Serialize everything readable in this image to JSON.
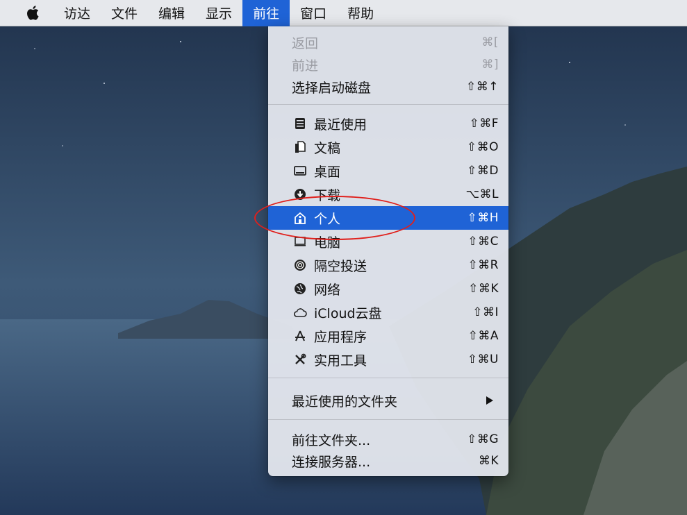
{
  "menubar": {
    "apple_icon": "apple-logo-icon",
    "items": [
      "访达",
      "文件",
      "编辑",
      "显示",
      "前往",
      "窗口",
      "帮助"
    ],
    "active": "前往"
  },
  "go_menu": {
    "back": {
      "label": "返回",
      "shortcut": "⌘["
    },
    "forward": {
      "label": "前进",
      "shortcut": "⌘]"
    },
    "startup_disk": {
      "label": "选择启动磁盘",
      "shortcut": "⇧⌘↑"
    },
    "recents": {
      "label": "最近使用",
      "shortcut": "⇧⌘F",
      "icon": "recents-icon"
    },
    "documents": {
      "label": "文稿",
      "shortcut": "⇧⌘O",
      "icon": "documents-icon"
    },
    "desktop": {
      "label": "桌面",
      "shortcut": "⇧⌘D",
      "icon": "desktop-icon"
    },
    "downloads": {
      "label": "下载",
      "shortcut": "⌥⌘L",
      "icon": "downloads-icon"
    },
    "home": {
      "label": "个人",
      "shortcut": "⇧⌘H",
      "icon": "home-icon"
    },
    "computer": {
      "label": "电脑",
      "shortcut": "⇧⌘C",
      "icon": "computer-icon"
    },
    "airdrop": {
      "label": "隔空投送",
      "shortcut": "⇧⌘R",
      "icon": "airdrop-icon"
    },
    "network": {
      "label": "网络",
      "shortcut": "⇧⌘K",
      "icon": "network-icon"
    },
    "icloud": {
      "label": "iCloud云盘",
      "shortcut": "⇧⌘I",
      "icon": "cloud-icon"
    },
    "applications": {
      "label": "应用程序",
      "shortcut": "⇧⌘A",
      "icon": "applications-icon"
    },
    "utilities": {
      "label": "实用工具",
      "shortcut": "⇧⌘U",
      "icon": "utilities-icon"
    },
    "recent_folders": {
      "label": "最近使用的文件夹"
    },
    "go_to_folder": {
      "label": "前往文件夹...",
      "shortcut": "⇧⌘G"
    },
    "connect_server": {
      "label": "连接服务器...",
      "shortcut": "⌘K"
    }
  },
  "colors": {
    "highlight": "#1f63d6",
    "annotation": "#e0201c",
    "menu_background": "#e2e5ec"
  }
}
